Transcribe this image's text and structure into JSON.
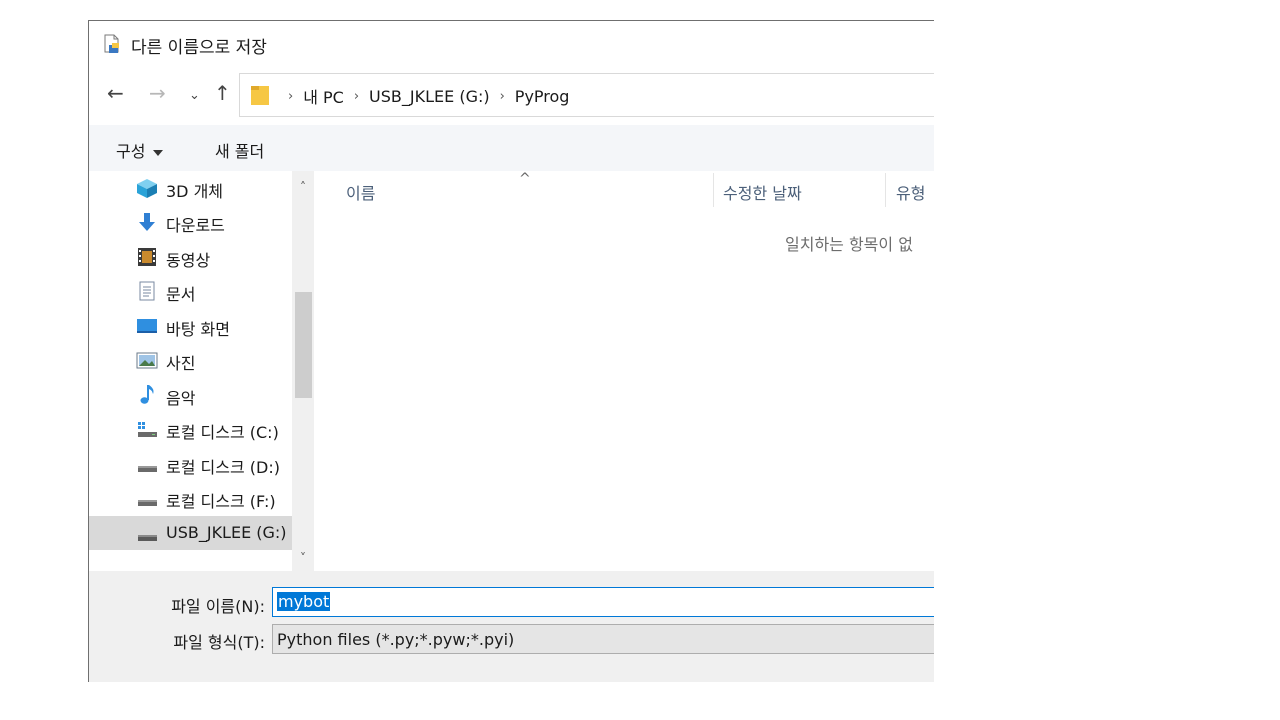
{
  "dialog": {
    "title": "다른 이름으로 저장"
  },
  "address": {
    "crumbs": [
      "내 PC",
      "USB_JKLEE (G:)",
      "PyProg"
    ]
  },
  "toolbar": {
    "organize_label": "구성",
    "new_folder_label": "새 폴더"
  },
  "nav": {
    "items": [
      {
        "label": "3D 개체",
        "icon": "cube-icon"
      },
      {
        "label": "다운로드",
        "icon": "download-arrow-icon"
      },
      {
        "label": "동영상",
        "icon": "film-icon"
      },
      {
        "label": "문서",
        "icon": "document-icon"
      },
      {
        "label": "바탕 화면",
        "icon": "desktop-icon"
      },
      {
        "label": "사진",
        "icon": "picture-icon"
      },
      {
        "label": "음악",
        "icon": "music-note-icon"
      },
      {
        "label": "로컬 디스크 (C:)",
        "icon": "windows-drive-icon"
      },
      {
        "label": "로컬 디스크 (D:)",
        "icon": "drive-icon"
      },
      {
        "label": "로컬 디스크 (F:)",
        "icon": "drive-icon"
      },
      {
        "label": "USB_JKLEE (G:)",
        "icon": "drive-icon",
        "selected": true
      }
    ]
  },
  "list": {
    "columns": [
      "이름",
      "수정한 날짜",
      "유형"
    ],
    "empty_message": "일치하는 항목이 없"
  },
  "save": {
    "filename_label": "파일 이름(N):",
    "filename_value": "mybot",
    "filetype_label": "파일 형식(T):",
    "filetype_value": "Python files (*.py;*.pyw;*.pyi)"
  },
  "colors": {
    "accent": "#0078d7",
    "selected_row": "#d9d9d9",
    "folder": "#f6c744"
  }
}
